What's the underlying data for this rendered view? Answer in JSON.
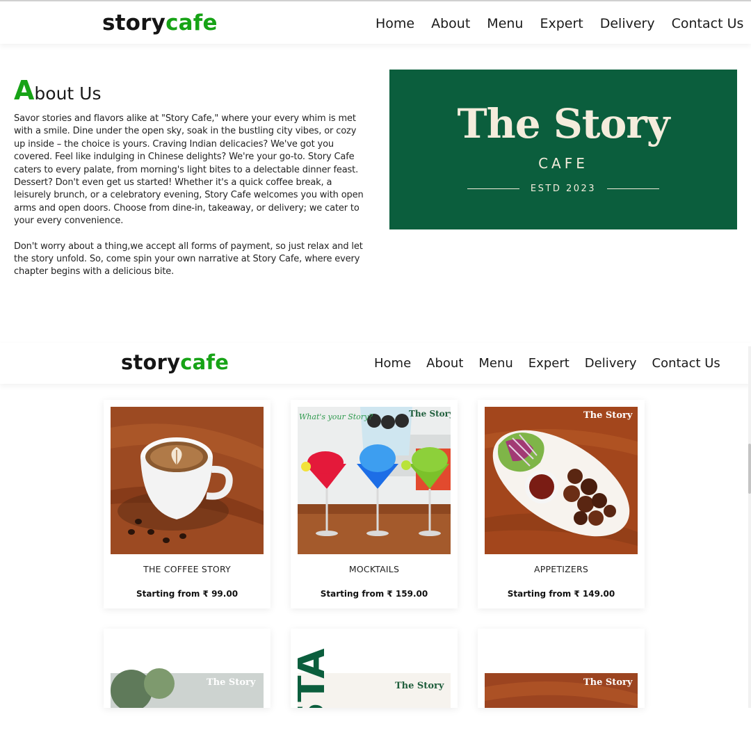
{
  "nav": {
    "logo_part1": "story",
    "logo_part2": "cafe",
    "items": [
      "Home",
      "About",
      "Menu",
      "Expert",
      "Delivery",
      "Contact Us"
    ]
  },
  "about": {
    "heading_initial": "A",
    "heading_rest": "bout Us",
    "paragraph1": "Savor stories and flavors alike at \"Story Cafe,\" where your every whim is met with a smile. Dine under the open sky, soak in the bustling city vibes, or cozy up inside – the choice is yours. Craving Indian delicacies? We've got you covered. Feel like indulging in Chinese delights? We're your go-to. Story Cafe caters to every palate, from morning's light bites to a delectable dinner feast. Dessert? Don't even get us started! Whether it's a quick coffee break, a leisurely brunch, or a celebratory evening, Story Cafe welcomes you with open arms and open doors. Choose from dine-in, takeaway, or delivery; we cater to your every convenience.",
    "paragraph2": "Don't worry about a thing,we accept all forms of payment, so just relax and let the story unfold. So, come spin your own narrative at Story Cafe, where every chapter begins with a delicious bite."
  },
  "brand": {
    "title": "The Story",
    "subtitle": "CAFE",
    "estd": "ESTD 2023",
    "bg_color": "#0b5e3d"
  },
  "image_tags": {
    "cafe_logo": "The Story",
    "mocktail_wall": "What's your Story?",
    "pasta_letters": "STA"
  },
  "products": [
    {
      "title": "THE COFFEE STORY",
      "price": "Starting from ₹ 99.00"
    },
    {
      "title": "MOCKTAILS",
      "price": "Starting from ₹ 159.00"
    },
    {
      "title": "APPETIZERS",
      "price": "Starting from ₹ 149.00"
    }
  ],
  "colors": {
    "accent": "#17a316",
    "text": "#1a1a1a"
  }
}
